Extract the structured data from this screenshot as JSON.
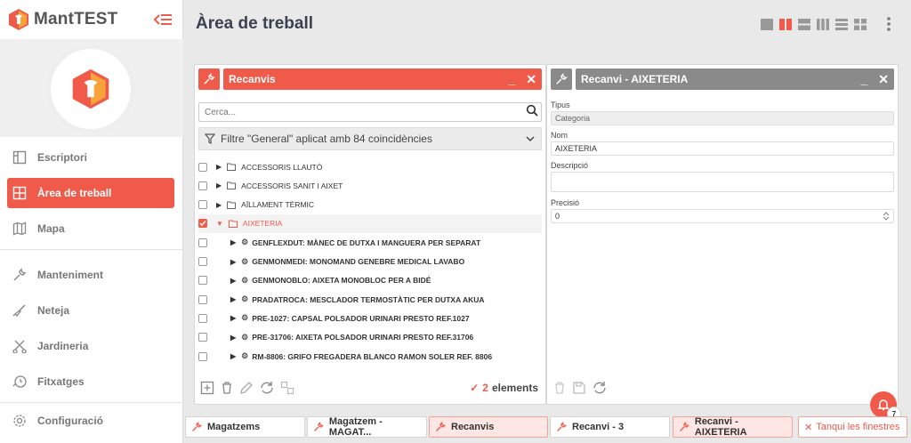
{
  "app": {
    "name": "MantTEST"
  },
  "page": {
    "title": "Àrea de treball"
  },
  "sidebar": {
    "items": [
      {
        "label": "Escriptori",
        "icon": "desktop-icon"
      },
      {
        "label": "Àrea de treball",
        "icon": "workspace-icon",
        "active": true
      },
      {
        "label": "Mapa",
        "icon": "map-icon"
      },
      {
        "label": "Manteniment",
        "icon": "wrench-icon"
      },
      {
        "label": "Neteja",
        "icon": "broom-icon"
      },
      {
        "label": "Jardineria",
        "icon": "garden-icon"
      },
      {
        "label": "Fitxatges",
        "icon": "clock-in-icon"
      },
      {
        "label": "Configuració",
        "icon": "gear-icon"
      }
    ]
  },
  "panel_left": {
    "title": "Recanvis",
    "search_placeholder": "Cerca...",
    "filter_text": "Filtre \"General\" aplicat amb 84 coincidències",
    "rows": [
      {
        "label": "ACCESSORIS LLAUTÓ",
        "type": "folder",
        "checked": false
      },
      {
        "label": "ACCESSORIS SANIT I AIXET",
        "type": "folder",
        "checked": false
      },
      {
        "label": "AÏLLAMENT TÈRMIC",
        "type": "folder",
        "checked": false
      },
      {
        "label": "AIXETERIA",
        "type": "folder",
        "checked": true,
        "expanded": true
      },
      {
        "label": "GENFLEXDUT: MÀNEC DE DUTXA I MANGUERA PER SEPARAT",
        "type": "item",
        "checked": false
      },
      {
        "label": "GENMONMEDI: MONOMAND GENEBRE MEDICAL LAVABO",
        "type": "item",
        "checked": false
      },
      {
        "label": "GENMONOBLO: AIXETA MONOBLOC PER A BIDÉ",
        "type": "item",
        "checked": false
      },
      {
        "label": "PRADATROCA: MESCLADOR TERMOSTÀTIC PER DUTXA AKUA",
        "type": "item",
        "checked": false
      },
      {
        "label": "PRE-1027: CAPSAL POLSADOR URINARI PRESTO REF.1027",
        "type": "item",
        "checked": false
      },
      {
        "label": "PRE-31706: AIXETA POLSADOR URINARI PRESTO REF.31706",
        "type": "item",
        "checked": false
      },
      {
        "label": "RM-8806: GRIFO FREGADERA BLANCO RAMON SOLER REF. 8806",
        "type": "item",
        "checked": false
      }
    ],
    "count_value": "2",
    "count_label": "elements"
  },
  "panel_right": {
    "title": "Recanvi - AIXETERIA",
    "fields": {
      "tipus_label": "Tipus",
      "tipus_value": "Categoria",
      "nom_label": "Nom",
      "nom_value": "AIXETERIA",
      "descripcio_label": "Descripció",
      "descripcio_value": "",
      "precisio_label": "Precisió",
      "precisio_value": "0"
    }
  },
  "tabs": [
    {
      "label": "Magatzems",
      "active": false
    },
    {
      "label": "Magatzem - MAGAT...",
      "active": false
    },
    {
      "label": "Recanvis",
      "active": true
    },
    {
      "label": "Recanvi - 3",
      "active": false
    },
    {
      "label": "Recanvi - AIXETERIA",
      "active": true
    }
  ],
  "close_all_label": "Tanqui les finestres",
  "fab_badge": "7",
  "colors": {
    "accent": "#f05a4a",
    "gray_header": "#8a8a8a"
  }
}
